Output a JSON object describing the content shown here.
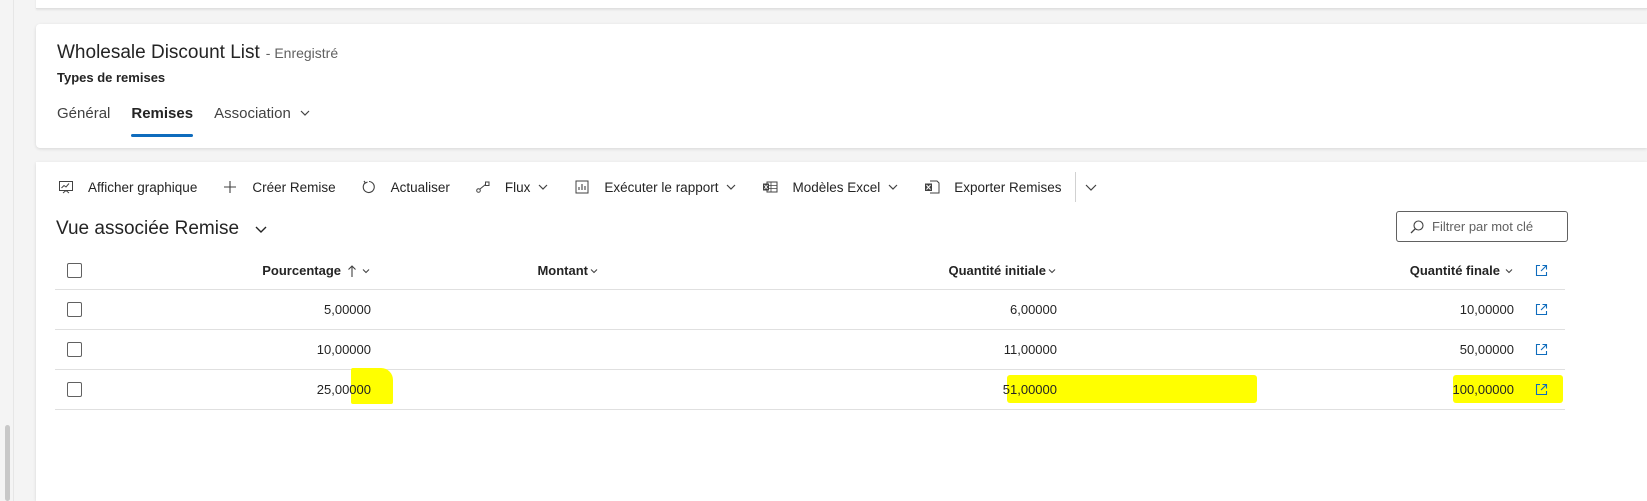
{
  "record": {
    "title": "Wholesale Discount List",
    "status": "- Enregistré",
    "entity": "Types de remises"
  },
  "tabs": [
    {
      "label": "Général",
      "active": false
    },
    {
      "label": "Remises",
      "active": true
    },
    {
      "label": "Association",
      "active": false,
      "has_dropdown": true
    }
  ],
  "commandbar": {
    "items": [
      {
        "label": "Afficher graphique",
        "icon": "chart-icon"
      },
      {
        "label": "Créer Remise",
        "icon": "plus-icon"
      },
      {
        "label": "Actualiser",
        "icon": "refresh-icon"
      },
      {
        "label": "Flux",
        "icon": "flow-icon",
        "has_dropdown": true
      },
      {
        "label": "Exécuter le rapport",
        "icon": "report-icon",
        "has_dropdown": true
      },
      {
        "label": "Modèles Excel",
        "icon": "excel-template-icon",
        "has_dropdown": true
      },
      {
        "label": "Exporter Remises",
        "icon": "excel-export-icon"
      }
    ],
    "overflow_icon": "chevron-down-icon"
  },
  "view": {
    "title": "Vue associée Remise"
  },
  "filter": {
    "placeholder": "Filtrer par mot clé",
    "value": ""
  },
  "grid": {
    "columns": [
      {
        "label": "Pourcentage",
        "sort": "ascending"
      },
      {
        "label": "Montant"
      },
      {
        "label": "Quantité initiale"
      },
      {
        "label": "Quantité finale"
      }
    ],
    "rows": [
      {
        "pourcentage": "5,00000",
        "montant": "",
        "quantite_initiale": "6,00000",
        "quantite_finale": "10,00000"
      },
      {
        "pourcentage": "10,00000",
        "montant": "",
        "quantite_initiale": "11,00000",
        "quantite_finale": "50,00000"
      },
      {
        "pourcentage": "25,00000",
        "montant": "",
        "quantite_initiale": "51,00000",
        "quantite_finale": "100,00000"
      }
    ]
  },
  "colors": {
    "accent": "#0f6cbd",
    "highlight": "#ffff00"
  }
}
